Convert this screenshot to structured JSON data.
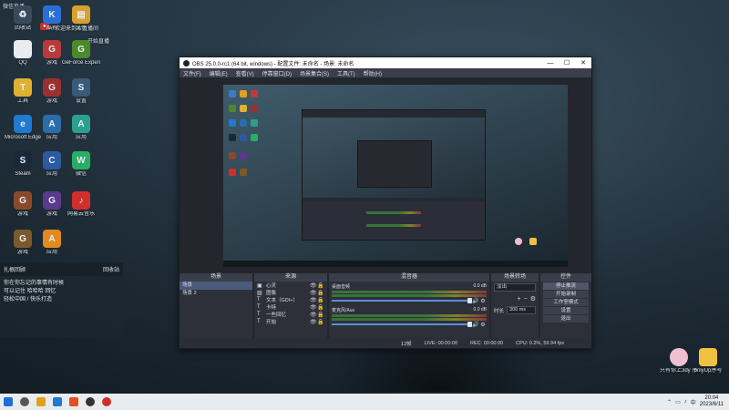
{
  "desktop": {
    "top_texts": [
      "微信直播",
      "欢迎来到本直播间",
      "开始直播"
    ],
    "icons": [
      {
        "label": "回收站",
        "color": "#3a4a5a",
        "glyph": "♻"
      },
      {
        "label": "酷狗",
        "color": "#2a6fd6",
        "glyph": "K"
      },
      {
        "label": "文件",
        "color": "#d8a030",
        "glyph": "▤"
      },
      {
        "label": "QQ",
        "color": "#e9ecef",
        "glyph": "Q"
      },
      {
        "label": "游戏",
        "color": "#b83a3a",
        "glyph": "G"
      },
      {
        "label": "GeForce Experience",
        "color": "#4a8a2a",
        "glyph": "G"
      },
      {
        "label": "工具",
        "color": "#e0b030",
        "glyph": "T"
      },
      {
        "label": "游戏",
        "color": "#9a3030",
        "glyph": "G"
      },
      {
        "label": "设置",
        "color": "#3a5a7a",
        "glyph": "S"
      },
      {
        "label": "Microsoft Edge",
        "color": "#1f7ad0",
        "glyph": "e"
      },
      {
        "label": "应用",
        "color": "#2b6da8",
        "glyph": "A"
      },
      {
        "label": "应用",
        "color": "#2aa090",
        "glyph": "A"
      },
      {
        "label": "Steam",
        "color": "#1b2838",
        "glyph": "S"
      },
      {
        "label": "应用",
        "color": "#2c5aa0",
        "glyph": "C"
      },
      {
        "label": "微信",
        "color": "#2aae67",
        "glyph": "W"
      },
      {
        "label": "游戏",
        "color": "#8a4a2a",
        "glyph": "G"
      },
      {
        "label": "游戏",
        "color": "#5a3a8a",
        "glyph": "G"
      },
      {
        "label": "网易云音乐",
        "color": "#d0302c",
        "glyph": "♪"
      },
      {
        "label": "游戏",
        "color": "#7a5a2a",
        "glyph": "G"
      },
      {
        "label": "应用",
        "color": "#e08a20",
        "glyph": "A"
      }
    ],
    "widget": {
      "header": "扎根回顾",
      "header_right": "回收站",
      "lines": [
        "你在你忘记的事情有时候",
        "可以记住 哈哈哈 回忆",
        "轻松中国 / 快乐打造"
      ]
    },
    "right_icons": [
      {
        "label": "只有你上3dy 序号小工具...",
        "color": "#f0c0d0"
      },
      {
        "label": "onlyUp序号",
        "color": "#f0c040"
      }
    ]
  },
  "obs": {
    "title": "OBS 25.0.0-rc1 (64 bit, windows) - 配置文件: 未命名 - 场景: 未命名",
    "menus": [
      "文件(F)",
      "编辑(E)",
      "查看(V)",
      "停靠窗口(D)",
      "场景集合(S)",
      "工具(T)",
      "帮助(H)"
    ],
    "docks": {
      "scenes": {
        "title": "场景",
        "items": [
          "场景",
          "场景 2"
        ]
      },
      "sources": {
        "title": "来源",
        "items": [
          {
            "name": "心灵",
            "icon": "▣"
          },
          {
            "name": "图像",
            "icon": "▨"
          },
          {
            "name": "文本（GDI+）",
            "icon": "T"
          },
          {
            "name": "卡特",
            "icon": "T"
          },
          {
            "name": "一些回忆",
            "icon": "T"
          },
          {
            "name": "开始",
            "icon": "T"
          }
        ]
      },
      "mixer": {
        "title": "混音器",
        "channels": [
          {
            "name": "桌面音频",
            "db": "0.0 dB"
          },
          {
            "name": "麦克风/Aux",
            "db": "0.0 dB"
          }
        ]
      },
      "transitions": {
        "title": "场景转场",
        "type": "淡出",
        "duration_label": "时长",
        "duration": "300 ms"
      },
      "controls": {
        "title": "控件",
        "buttons": [
          "停止推流",
          "开始录制",
          "工作室模式",
          "设置",
          "退出"
        ]
      }
    },
    "status": {
      "dropped": "12帧",
      "live": "LIVE: 00:00:00",
      "rec": "REC: 00:00:00",
      "cpu": "CPU: 0.2%, 59.94 fps"
    }
  },
  "taskbar": {
    "time": "20:04",
    "date": "2023/6/11",
    "icons": [
      {
        "name": "start",
        "color": "#1f6ed4"
      },
      {
        "name": "search",
        "color": "#555555"
      },
      {
        "name": "file-explorer",
        "color": "#e0a020"
      },
      {
        "name": "edge",
        "color": "#1f7ad0"
      },
      {
        "name": "app",
        "color": "#e05020"
      },
      {
        "name": "obs",
        "color": "#333333"
      },
      {
        "name": "netease-music",
        "color": "#d0302c"
      }
    ]
  }
}
